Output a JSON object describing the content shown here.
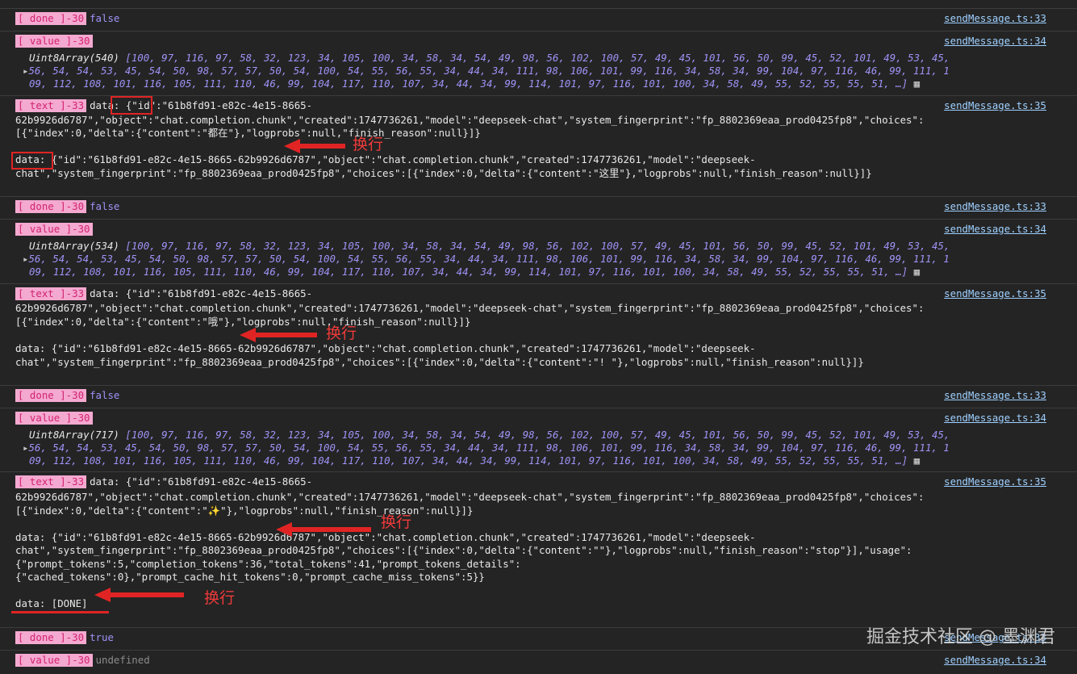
{
  "entries": [
    {
      "tag": "[ done ]-30",
      "value": "false",
      "source": "sendMessage.ts:33"
    },
    {
      "tag": "[ value ]-30",
      "source": "sendMessage.ts:34",
      "array_label": "Uint8Array(540)",
      "line1": "[100, 97, 116, 97, 58, 32, 123, 34, 105, 100, 34, 58, 34, 54, 49, 98, 56, 102, 100, 57, 49, 45, 101, 56, 50, 99, 45, 52, 101, 49, 53, 45,",
      "line2": "56, 54, 54, 53, 45, 54, 50, 98, 57, 57, 50, 54, 100, 54, 55, 56, 55, 34, 44, 34, 111, 98, 106, 101, 99, 116, 34, 58, 34, 99, 104, 97, 116, 46, 99, 111, 1",
      "line3": "09, 112, 108, 101, 116, 105, 111, 110, 46, 99, 104, 117, 110, 107, 34, 44, 34, 99, 114, 101, 97, 116, 101, 100, 34, 58, 49, 55, 52, 55, 55, 51, …]"
    },
    {
      "tag": "[ text ]-33",
      "source": "sendMessage.ts:35",
      "lines": [
        "data: {\"id\":\"61b8fd91-e82c-4e15-8665-",
        "62b9926d6787\",\"object\":\"chat.completion.chunk\",\"created\":1747736261,\"model\":\"deepseek-chat\",\"system_fingerprint\":\"fp_8802369eaa_prod0425fp8\",\"choices\":",
        "[{\"index\":0,\"delta\":{\"content\":\"都在\"},\"logprobs\":null,\"finish_reason\":null}]}",
        "",
        "data: {\"id\":\"61b8fd91-e82c-4e15-8665-62b9926d6787\",\"object\":\"chat.completion.chunk\",\"created\":1747736261,\"model\":\"deepseek-",
        "chat\",\"system_fingerprint\":\"fp_8802369eaa_prod0425fp8\",\"choices\":[{\"index\":0,\"delta\":{\"content\":\"这里\"},\"logprobs\":null,\"finish_reason\":null}]}"
      ]
    },
    {
      "tag": "[ done ]-30",
      "value": "false",
      "source": "sendMessage.ts:33"
    },
    {
      "tag": "[ value ]-30",
      "source": "sendMessage.ts:34",
      "array_label": "Uint8Array(534)",
      "line1": "[100, 97, 116, 97, 58, 32, 123, 34, 105, 100, 34, 58, 34, 54, 49, 98, 56, 102, 100, 57, 49, 45, 101, 56, 50, 99, 45, 52, 101, 49, 53, 45,",
      "line2": "56, 54, 54, 53, 45, 54, 50, 98, 57, 57, 50, 54, 100, 54, 55, 56, 55, 34, 44, 34, 111, 98, 106, 101, 99, 116, 34, 58, 34, 99, 104, 97, 116, 46, 99, 111, 1",
      "line3": "09, 112, 108, 101, 116, 105, 111, 110, 46, 99, 104, 117, 110, 107, 34, 44, 34, 99, 114, 101, 97, 116, 101, 100, 34, 58, 49, 55, 52, 55, 55, 51, …]"
    },
    {
      "tag": "[ text ]-33",
      "source": "sendMessage.ts:35",
      "lines": [
        "data: {\"id\":\"61b8fd91-e82c-4e15-8665-",
        "62b9926d6787\",\"object\":\"chat.completion.chunk\",\"created\":1747736261,\"model\":\"deepseek-chat\",\"system_fingerprint\":\"fp_8802369eaa_prod0425fp8\",\"choices\":",
        "[{\"index\":0,\"delta\":{\"content\":\"哦\"},\"logprobs\":null,\"finish_reason\":null}]}",
        "",
        "data: {\"id\":\"61b8fd91-e82c-4e15-8665-62b9926d6787\",\"object\":\"chat.completion.chunk\",\"created\":1747736261,\"model\":\"deepseek-",
        "chat\",\"system_fingerprint\":\"fp_8802369eaa_prod0425fp8\",\"choices\":[{\"index\":0,\"delta\":{\"content\":\"! \"},\"logprobs\":null,\"finish_reason\":null}]}"
      ]
    },
    {
      "tag": "[ done ]-30",
      "value": "false",
      "source": "sendMessage.ts:33"
    },
    {
      "tag": "[ value ]-30",
      "source": "sendMessage.ts:34",
      "array_label": "Uint8Array(717)",
      "line1": "[100, 97, 116, 97, 58, 32, 123, 34, 105, 100, 34, 58, 34, 54, 49, 98, 56, 102, 100, 57, 49, 45, 101, 56, 50, 99, 45, 52, 101, 49, 53, 45,",
      "line2": "56, 54, 54, 53, 45, 54, 50, 98, 57, 57, 50, 54, 100, 54, 55, 56, 55, 34, 44, 34, 111, 98, 106, 101, 99, 116, 34, 58, 34, 99, 104, 97, 116, 46, 99, 111, 1",
      "line3": "09, 112, 108, 101, 116, 105, 111, 110, 46, 99, 104, 117, 110, 107, 34, 44, 34, 99, 114, 101, 97, 116, 101, 100, 34, 58, 49, 55, 52, 55, 55, 51, …]"
    },
    {
      "tag": "[ text ]-33",
      "source": "sendMessage.ts:35",
      "lines": [
        "data: {\"id\":\"61b8fd91-e82c-4e15-8665-",
        "62b9926d6787\",\"object\":\"chat.completion.chunk\",\"created\":1747736261,\"model\":\"deepseek-chat\",\"system_fingerprint\":\"fp_8802369eaa_prod0425fp8\",\"choices\":",
        "[{\"index\":0,\"delta\":{\"content\":\"✨\"},\"logprobs\":null,\"finish_reason\":null}]}",
        "",
        "data: {\"id\":\"61b8fd91-e82c-4e15-8665-62b9926d6787\",\"object\":\"chat.completion.chunk\",\"created\":1747736261,\"model\":\"deepseek-",
        "chat\",\"system_fingerprint\":\"fp_8802369eaa_prod0425fp8\",\"choices\":[{\"index\":0,\"delta\":{\"content\":\"\"},\"logprobs\":null,\"finish_reason\":\"stop\"}],\"usage\":",
        "{\"prompt_tokens\":5,\"completion_tokens\":36,\"total_tokens\":41,\"prompt_tokens_details\":",
        "{\"cached_tokens\":0},\"prompt_cache_hit_tokens\":0,\"prompt_cache_miss_tokens\":5}}",
        "",
        "data: [DONE]"
      ]
    },
    {
      "tag": "[ done ]-30",
      "value": "true",
      "source": "sendMessage.ts:33"
    },
    {
      "tag": "[ value ]-30",
      "value": "undefined",
      "source": "sendMessage.ts:34"
    }
  ],
  "annotation": "换行",
  "watermark": "掘金技术社区 @ 墨渊君",
  "icons": {
    "expand": "expand-triangle-icon",
    "grid": "grid-icon",
    "arrow": "red-arrow-icon"
  },
  "colors": {
    "tag_bg": "#f4a9d0",
    "tag_fg": "#d2236f",
    "keyword": "#9f93f7",
    "link": "#9fd0ff",
    "annotation": "#f03a3a"
  }
}
